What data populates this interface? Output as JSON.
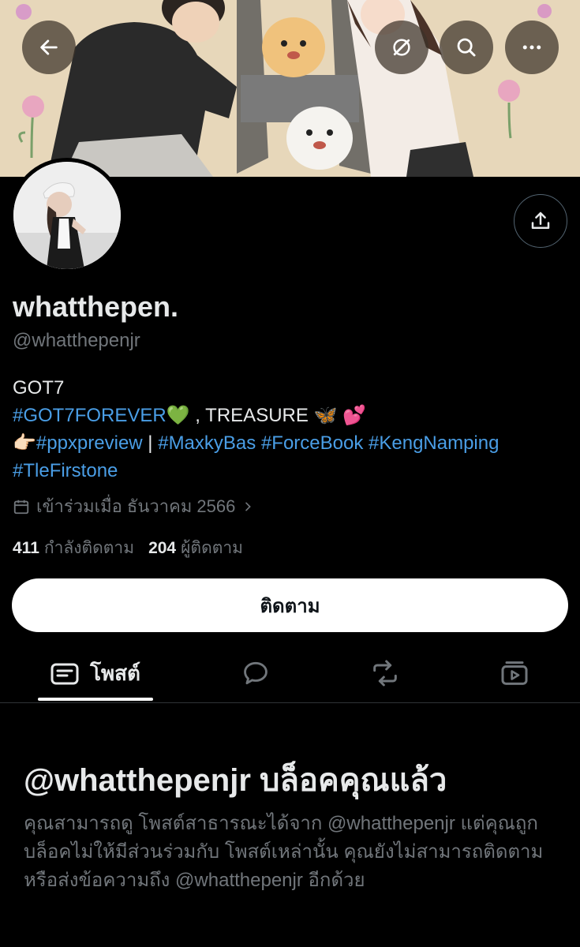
{
  "header": {
    "back_icon": "arrow-left-icon",
    "mute_icon": "slash-circle-icon",
    "search_icon": "search-icon",
    "more_icon": "more-horizontal-icon"
  },
  "profile": {
    "display_name": "whatthepen.",
    "handle": "@whatthepenjr",
    "share_icon": "share-upload-icon",
    "bio": {
      "line1": "GOT7",
      "line2_tag": "#GOT7FOREVER",
      "line2_emoji": "💚",
      "line2_rest": " , TREASURE ",
      "line2_emoji2": "🦋 💕",
      "line3_emoji": "👉🏻",
      "line3_tag1": "#ppxpreview",
      "line3_sep": " | ",
      "line3_tag2": "#MaxkyBas",
      "line3_tag3": "#ForceBook",
      "line3_tag4": "#KengNamping",
      "line4_tag": "#TleFirstone"
    },
    "joined": "เข้าร่วมเมื่อ ธันวาคม 2566",
    "following_count": "411",
    "following_label": "กำลังติดตาม",
    "followers_count": "204",
    "followers_label": "ผู้ติดตาม"
  },
  "follow_button": "ติดตาม",
  "tabs": [
    {
      "label": "โพสต์",
      "icon": "posts-card-icon",
      "active": true
    },
    {
      "label": "",
      "icon": "reply-bubble-icon"
    },
    {
      "label": "",
      "icon": "repost-icon"
    },
    {
      "label": "",
      "icon": "media-play-icon"
    }
  ],
  "blocked": {
    "title": "@whatthepenjr บล็อคคุณแล้ว",
    "line1": "คุณสามารถดู โพสต์สาธารณะได้จาก @whatthepenjr แต่คุณถูก",
    "line2": "บล็อคไม่ให้มีส่วนร่วมกับ โพสต์เหล่านั้น คุณยังไม่สามารถติดตาม",
    "line3": "หรือส่งข้อความถึง @whatthepenjr อีกด้วย"
  }
}
